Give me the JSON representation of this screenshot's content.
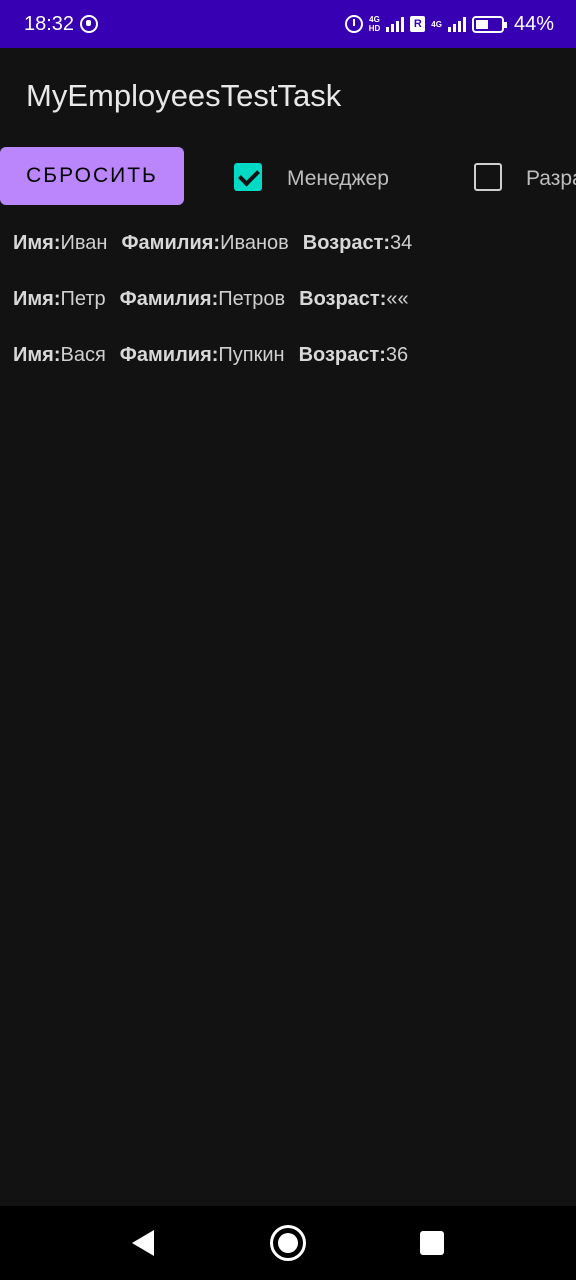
{
  "status_bar": {
    "time": "18:32",
    "network_1": "4G",
    "network_1_sub": "HD",
    "roaming_badge": "R",
    "network_2": "4G",
    "battery_percent": "44%",
    "icons": [
      "notification-icon",
      "alarm-icon",
      "signal-icon",
      "roaming-icon",
      "signal-icon",
      "battery-charging-icon"
    ]
  },
  "app_bar": {
    "title": "MyEmployeesTestTask"
  },
  "controls": {
    "reset_label": "СБРОСИТЬ",
    "filters": [
      {
        "label": "Менеджер",
        "checked": true
      },
      {
        "label": "Разработчик",
        "checked": false
      }
    ]
  },
  "employees": {
    "name_label": "Имя:",
    "surname_label": "Фамилия:",
    "age_label": "Возраст:",
    "rows": [
      {
        "name": "Иван",
        "surname": "Иванов",
        "age": "34"
      },
      {
        "name": "Петр",
        "surname": "Петров",
        "age": "««"
      },
      {
        "name": "Вася",
        "surname": "Пупкин",
        "age": "36"
      }
    ]
  },
  "nav_bar": {
    "icons": [
      "back-icon",
      "home-icon",
      "recents-icon"
    ]
  },
  "colors": {
    "status_bar": "#3700b3",
    "background": "#121212",
    "button": "#bb86fc",
    "checkbox_checked": "#03dac5"
  }
}
